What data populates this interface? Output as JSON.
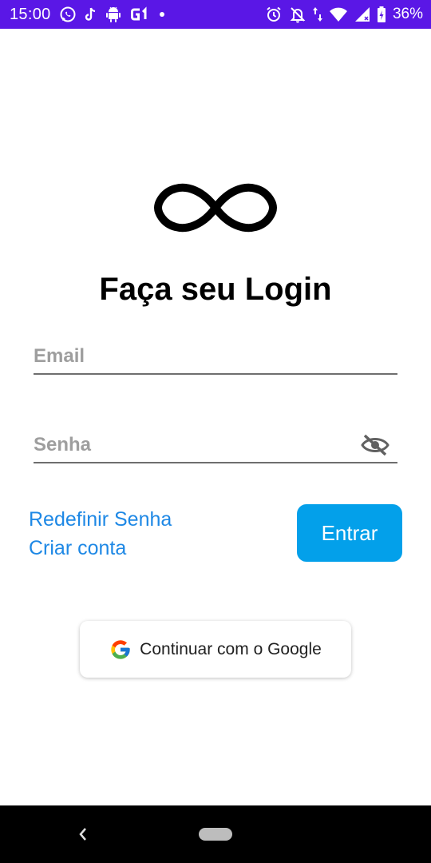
{
  "status_bar": {
    "time": "15:00",
    "notification_icons": [
      "whatsapp-icon",
      "tiktok-icon",
      "android-icon",
      "g1-icon",
      "dot-icon"
    ],
    "system_icons": [
      "alarm-icon",
      "notifications-off-icon",
      "data-arrows-icon",
      "wifi-icon",
      "signal-icon",
      "battery-charging-icon"
    ],
    "battery": "36%",
    "background": "#5a17e6"
  },
  "login": {
    "logo_icon": "infinity-icon",
    "title": "Faça seu Login",
    "email_placeholder": "Email",
    "email_value": "",
    "password_placeholder": "Senha",
    "password_value": "",
    "toggle_icon": "eye-off-icon",
    "reset_link": "Redefinir Senha",
    "create_link": "Criar conta",
    "enter_button": "Entrar",
    "google_button": "Continuar com o Google",
    "accent_color": "#03a0ea",
    "link_color": "#1e88e5"
  },
  "nav_bar": {
    "back_icon": "back-chevron-icon",
    "home_icon": "home-pill-icon"
  }
}
